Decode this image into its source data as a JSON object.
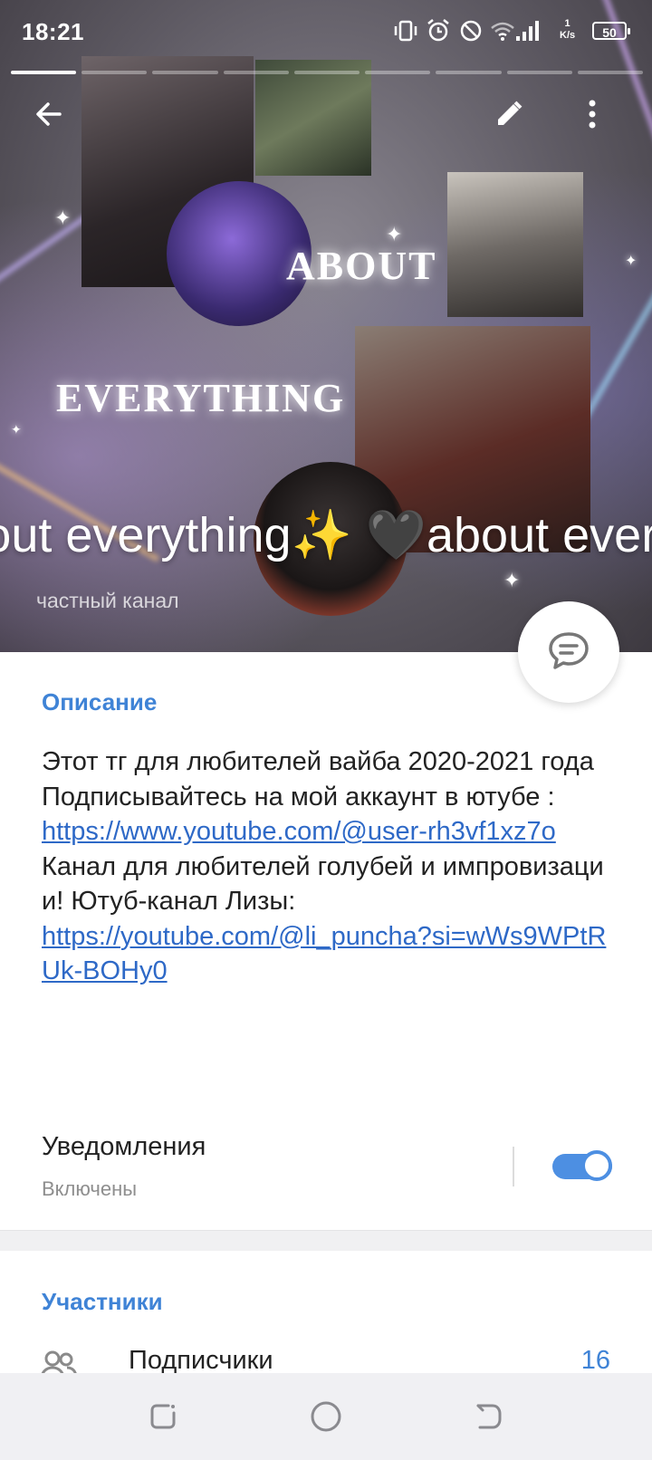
{
  "status_bar": {
    "time": "18:21",
    "net_speed_value": "1",
    "net_speed_unit": "K/s",
    "battery": "50"
  },
  "story_progress": {
    "segments": 9,
    "active_index": 0
  },
  "header": {
    "back_icon": "arrow-left-icon",
    "edit_icon": "pencil-icon",
    "more_icon": "more-vertical-icon",
    "cover_text_1": "ABOUT",
    "cover_text_2": "EVERYTHING",
    "channel_name": "🖤about everything✨  🖤about everything✨",
    "channel_type": "частный канал"
  },
  "fab": {
    "icon": "chat-bubble-icon"
  },
  "description": {
    "title": "Описание",
    "line1": "Этот тг для любителей вайба 2020-2021 года",
    "line2": "Подписывайтесь на мой аккаунт в ютубе :",
    "link1": "https://www.youtube.com/@user-rh3vf1xz7o",
    "line3": "Канал для любителей голубей и импровизации! Ютуб-канал Лизы:",
    "link2": "https://youtube.com/@li_puncha?si=wWs9WPtRUk-BOHy0"
  },
  "notifications": {
    "label": "Уведомления",
    "status": "Включены",
    "enabled": true
  },
  "members": {
    "title": "Участники",
    "subscribers_label": "Подписчики",
    "subscribers_count": "16",
    "icon": "users-icon"
  },
  "navbar": {
    "recents_icon": "recents-icon",
    "home_icon": "home-circle-icon",
    "back_icon": "nav-back-icon"
  },
  "colors": {
    "accent": "#3f83d6",
    "link": "#2e69c7",
    "toggle": "#4d8fe2"
  }
}
